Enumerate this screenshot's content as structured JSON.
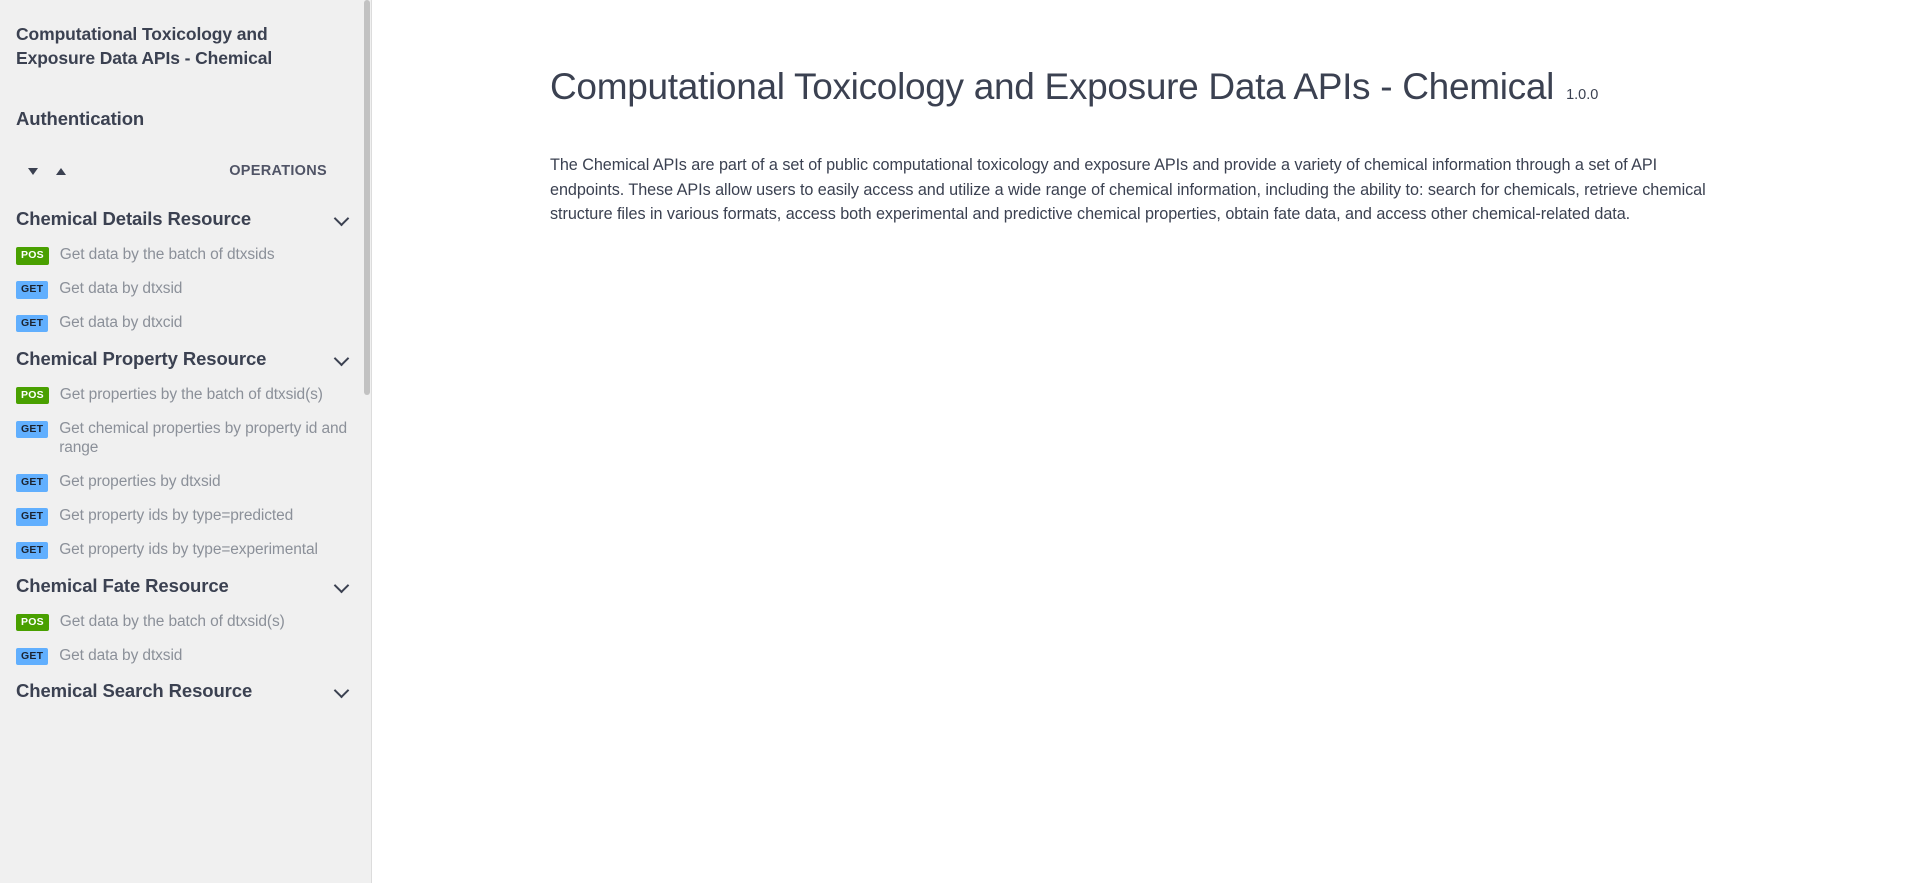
{
  "sidebar": {
    "title": "Computational Toxicology and Exposure Data APIs - Chemical",
    "authentication_label": "Authentication",
    "expand_all_icon": "caret-down-icon",
    "collapse_all_icon": "caret-up-icon",
    "operations_label": "OPERATIONS",
    "groups": [
      {
        "name": "Chemical Details Resource",
        "operations": [
          {
            "method": "POST",
            "method_short": "POS",
            "label": "Get data by the batch of dtxsids"
          },
          {
            "method": "GET",
            "method_short": "GET",
            "label": "Get data by dtxsid"
          },
          {
            "method": "GET",
            "method_short": "GET",
            "label": "Get data by dtxcid"
          }
        ]
      },
      {
        "name": "Chemical Property Resource",
        "operations": [
          {
            "method": "POST",
            "method_short": "POS",
            "label": "Get properties by the batch of dtxsid(s)"
          },
          {
            "method": "GET",
            "method_short": "GET",
            "label": "Get chemical properties by property id and range"
          },
          {
            "method": "GET",
            "method_short": "GET",
            "label": "Get properties by dtxsid"
          },
          {
            "method": "GET",
            "method_short": "GET",
            "label": "Get property ids by type=predicted"
          },
          {
            "method": "GET",
            "method_short": "GET",
            "label": "Get property ids by type=experimental"
          }
        ]
      },
      {
        "name": "Chemical Fate Resource",
        "operations": [
          {
            "method": "POST",
            "method_short": "POS",
            "label": "Get data by the batch of dtxsid(s)"
          },
          {
            "method": "GET",
            "method_short": "GET",
            "label": "Get data by dtxsid"
          }
        ]
      },
      {
        "name": "Chemical Search Resource",
        "operations": []
      }
    ]
  },
  "main": {
    "title": "Computational Toxicology and Exposure Data APIs - Chemical",
    "version": "1.0.0",
    "description": "The Chemical APIs are part of a set of public computational toxicology and exposure APIs and provide a variety of chemical information through a set of API endpoints. These APIs allow users to easily access and utilize a wide range of chemical information, including the ability to: search for chemicals, retrieve chemical structure files in various formats, access both experimental and predictive chemical properties, obtain fate data, and access other chemical-related data."
  },
  "colors": {
    "post_badge": "#49a000",
    "get_badge": "#61affe",
    "sidebar_bg": "#f0f0f0",
    "text_dark": "#3b4151",
    "text_muted": "#8b9099"
  }
}
